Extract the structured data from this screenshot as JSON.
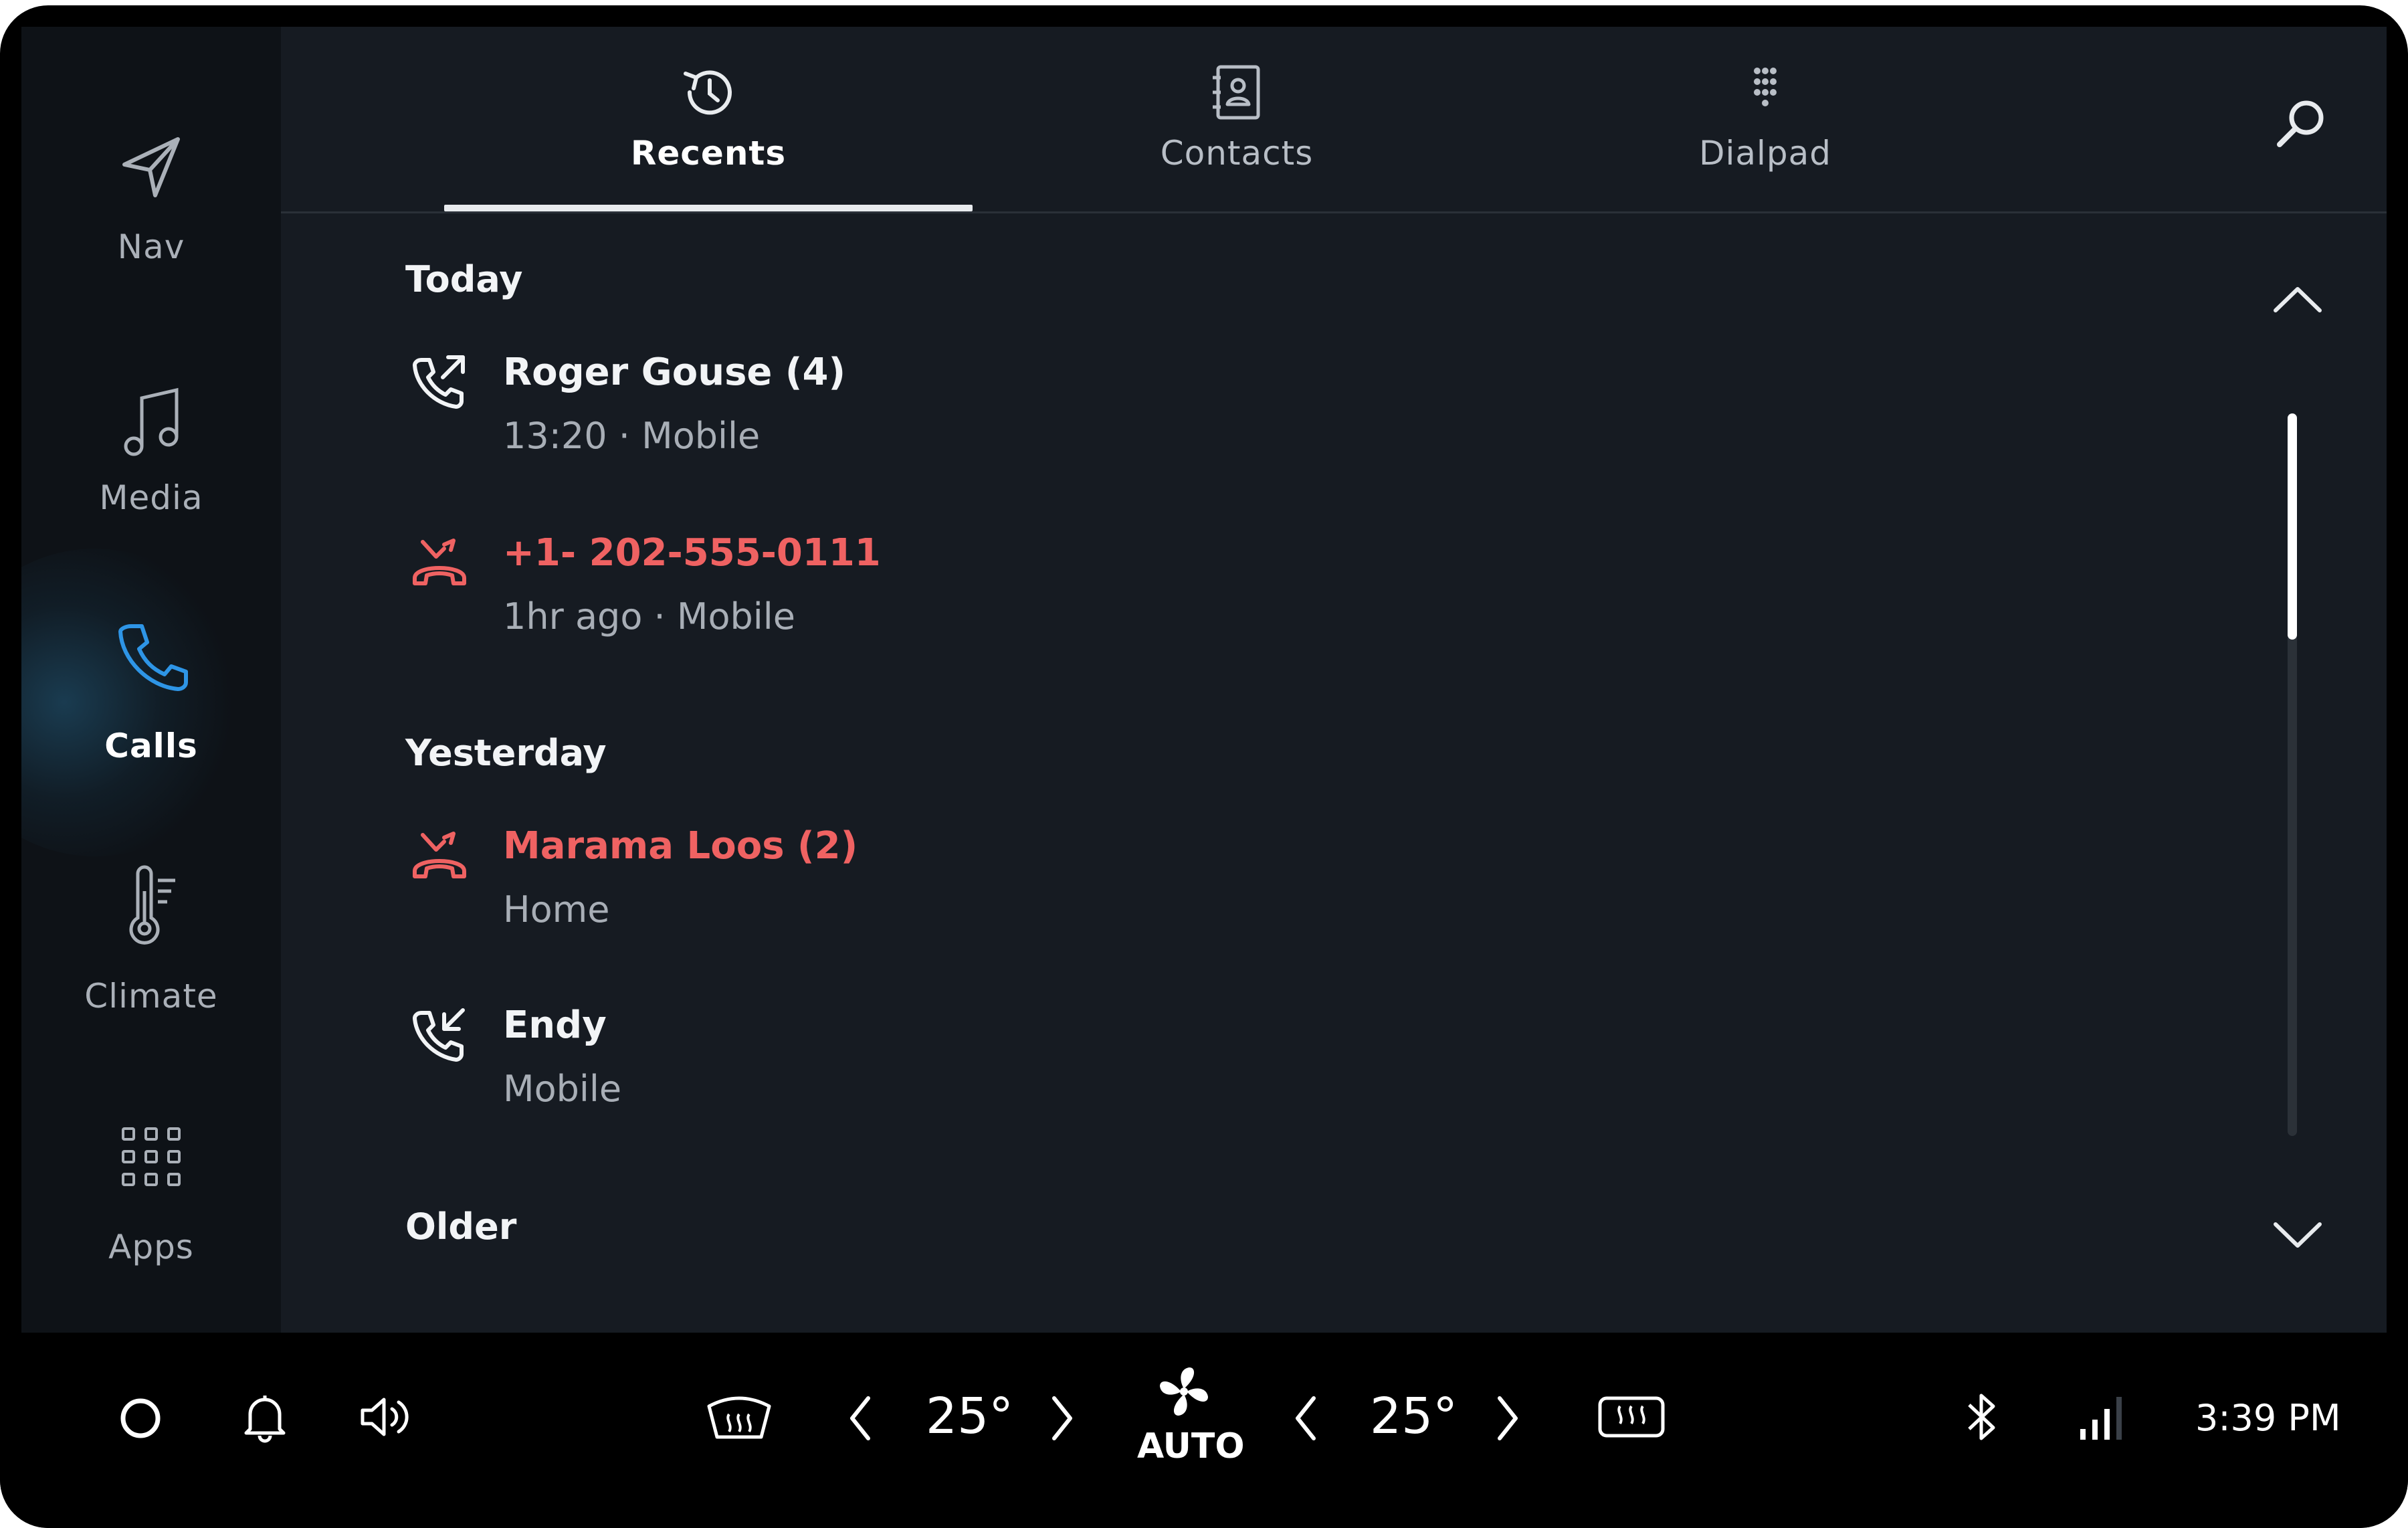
{
  "sidebar": {
    "items": [
      {
        "label": "Nav",
        "icon": "navigation-arrow-icon",
        "active": false
      },
      {
        "label": "Media",
        "icon": "music-note-icon",
        "active": false
      },
      {
        "label": "Calls",
        "icon": "phone-icon",
        "active": true
      },
      {
        "label": "Climate",
        "icon": "thermometer-icon",
        "active": false
      },
      {
        "label": "Apps",
        "icon": "apps-grid-icon",
        "active": false
      }
    ]
  },
  "tabs": [
    {
      "label": "Recents",
      "icon": "history-icon",
      "active": true
    },
    {
      "label": "Contacts",
      "icon": "contacts-book-icon",
      "active": false
    },
    {
      "label": "Dialpad",
      "icon": "dialpad-icon",
      "active": false
    }
  ],
  "search_icon": "search-icon",
  "sections": [
    {
      "title": "Today",
      "entries": [
        {
          "name": "Roger Gouse (4)",
          "detail": "13:20 · Mobile",
          "type": "outgoing",
          "icon": "outgoing-call-icon"
        },
        {
          "name": "+1- 202-555-0111",
          "detail": "1hr ago · Mobile",
          "type": "missed",
          "icon": "missed-call-icon"
        }
      ]
    },
    {
      "title": "Yesterday",
      "entries": [
        {
          "name": "Marama Loos (2)",
          "detail": "Home",
          "type": "missed",
          "icon": "missed-call-icon"
        },
        {
          "name": "Endy",
          "detail": "Mobile",
          "type": "incoming",
          "icon": "incoming-call-icon"
        }
      ]
    },
    {
      "title": "Older",
      "entries": []
    }
  ],
  "bottom_bar": {
    "left_temp": "25°",
    "right_temp": "25°",
    "fan_label": "AUTO",
    "time": "3:39 PM"
  },
  "colors": {
    "background": "#161b22",
    "sidebar": "#0e1217",
    "missed": "#ef6262",
    "accent": "#1e90e0"
  }
}
